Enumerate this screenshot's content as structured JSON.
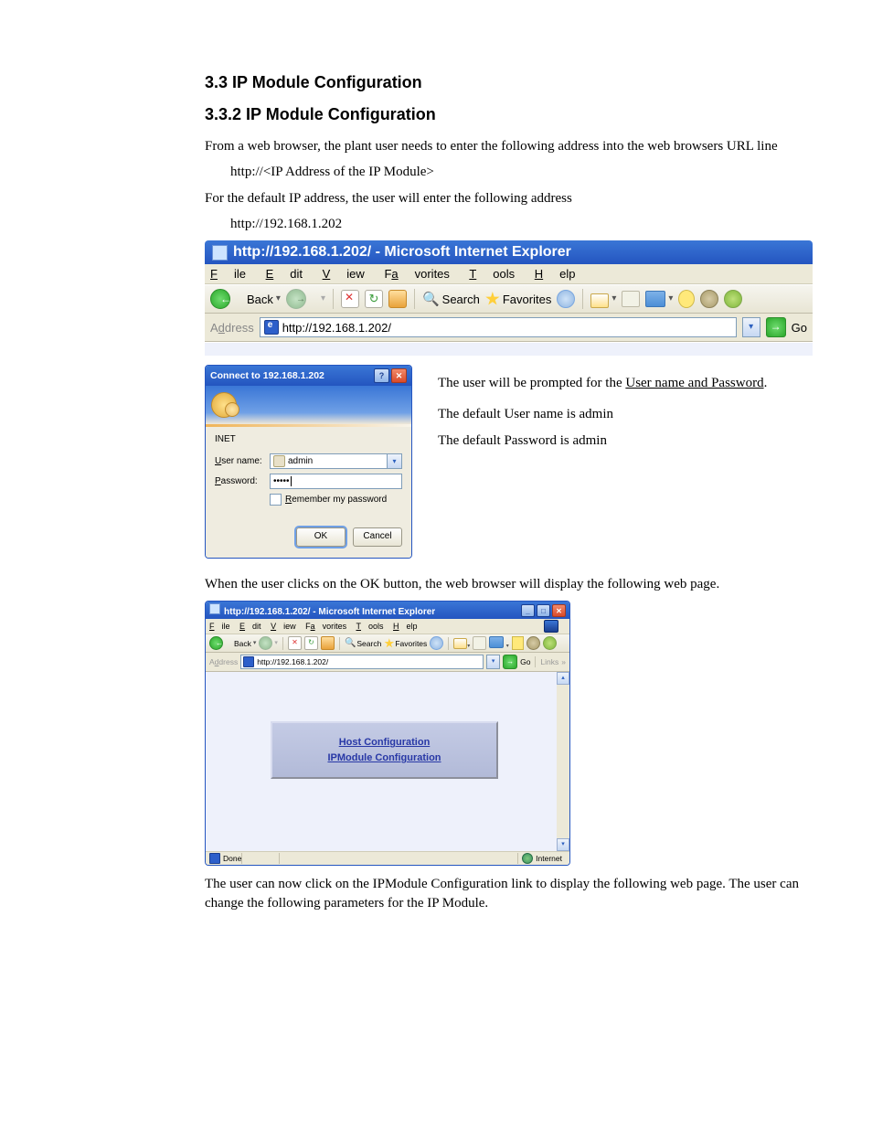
{
  "doc": {
    "heading1": "3.3 IP Module Configuration",
    "heading2": "3.3.2 IP Module Configuration",
    "p1": "From a web browser, the plant user needs to enter the following address into the web browsers URL line",
    "p2": "http://<IP Address of the IP Module>",
    "p3": "For the default IP address, the user will enter the following address",
    "p4": "http://192.168.1.202",
    "p5_a": "The user will be prompted for the ",
    "p5_b": "User name and Password",
    "p5_c": ".",
    "p6": "The default User name is admin",
    "p7": "The default Password is admin",
    "p8": "When the user clicks on the OK button, the web browser will display the following web page.",
    "p9": "The user can now click on the IPModule Configuration link to display the following web page. The user can change the following parameters for the IP Module."
  },
  "ie": {
    "title": "http://192.168.1.202/ - Microsoft Internet Explorer",
    "menus": {
      "file": "File",
      "edit": "Edit",
      "view": "View",
      "favorites": "Favorites",
      "tools": "Tools",
      "help": "Help"
    },
    "toolbar": {
      "back": "Back",
      "search": "Search",
      "favorites": "Favorites"
    },
    "address_label": "Address",
    "address_value": "http://192.168.1.202/",
    "go": "Go"
  },
  "auth": {
    "title": "Connect to 192.168.1.202",
    "realm": "INET",
    "user_label": "User name:",
    "user_value": "admin",
    "pass_label": "Password:",
    "pass_value": "•••••",
    "remember": "Remember my password",
    "ok": "OK",
    "cancel": "Cancel"
  },
  "mini": {
    "title": "http://192.168.1.202/ - Microsoft Internet Explorer",
    "address_value": "http://192.168.1.202/",
    "links_label": "Links",
    "link1": "Host Configuration",
    "link2": "IPModule Configuration",
    "status_left": "Done",
    "status_zone": "Internet"
  }
}
